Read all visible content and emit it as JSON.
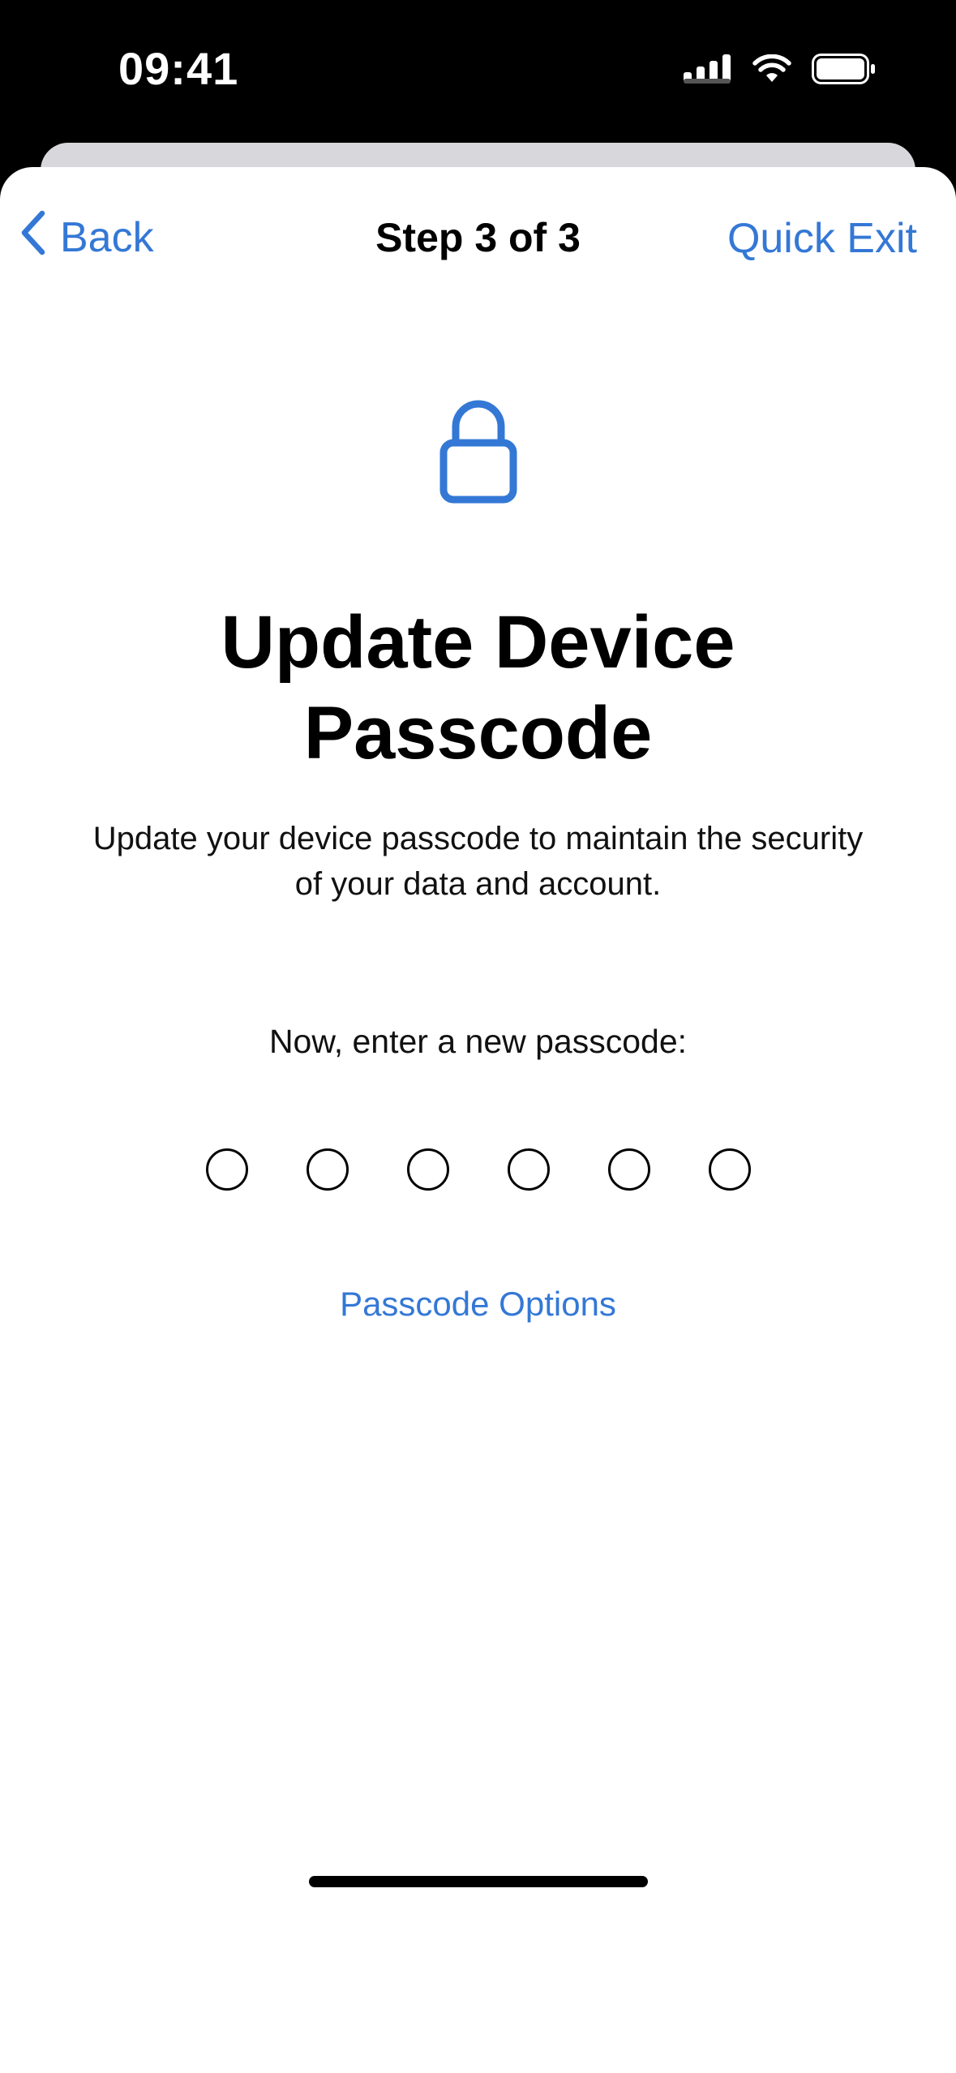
{
  "status_bar": {
    "time": "09:41",
    "icons": [
      "cellular-signal-icon",
      "wifi-icon",
      "battery-icon"
    ]
  },
  "nav": {
    "back_label": "Back",
    "title": "Step 3 of 3",
    "quick_exit_label": "Quick Exit"
  },
  "main": {
    "icon": "lock-icon",
    "title": "Update Device Passcode",
    "subtitle": "Update your device passcode to maintain the security of your data and account.",
    "prompt": "Now, enter a new passcode:",
    "passcode_length": 6,
    "passcode_entered": 0,
    "options_label": "Passcode Options"
  },
  "colors": {
    "accent": "#3478d6",
    "background": "#ffffff",
    "status_bar": "#000000"
  }
}
